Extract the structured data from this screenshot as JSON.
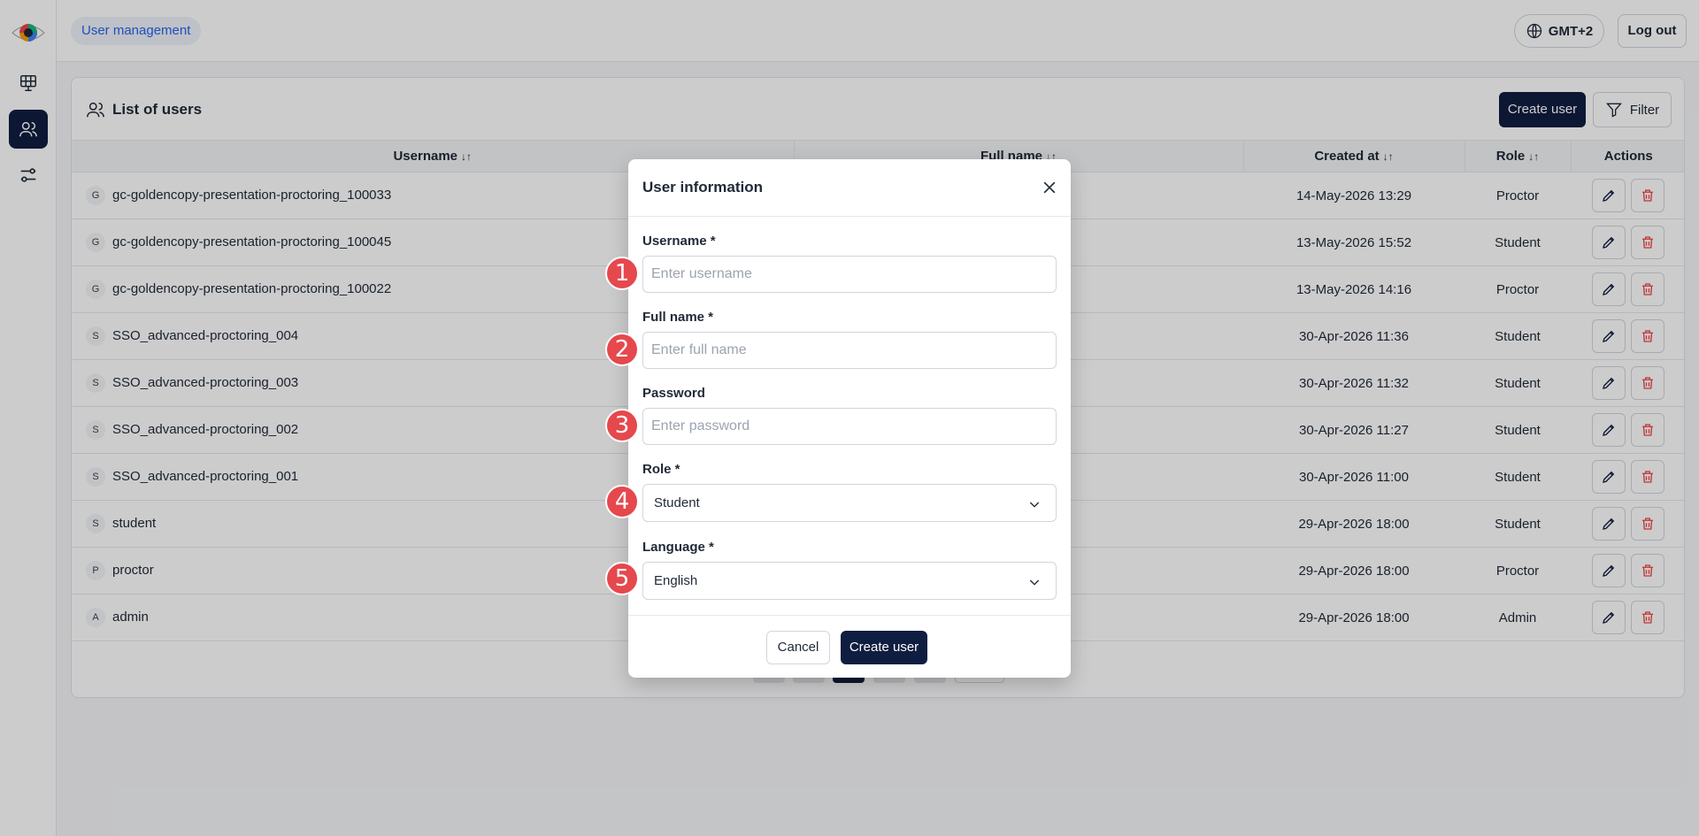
{
  "header": {
    "breadcrumb": "User management",
    "timezone_label": "GMT+2",
    "logout_label": "Log out"
  },
  "sidebar": {
    "items": [
      "dashboard",
      "users",
      "settings"
    ],
    "active": "users"
  },
  "card": {
    "title": "List of users",
    "create_label": "Create user",
    "filter_label": "Filter"
  },
  "table": {
    "columns": [
      "Username",
      "Full name",
      "Created at",
      "Role",
      "Actions"
    ],
    "rows": [
      {
        "initial": "G",
        "username": "gc-goldencopy-presentation-proctoring_100033",
        "created": "14-May-2026 13:29",
        "role": "Proctor"
      },
      {
        "initial": "G",
        "username": "gc-goldencopy-presentation-proctoring_100045",
        "created": "13-May-2026 15:52",
        "role": "Student"
      },
      {
        "initial": "G",
        "username": "gc-goldencopy-presentation-proctoring_100022",
        "created": "13-May-2026 14:16",
        "role": "Proctor"
      },
      {
        "initial": "S",
        "username": "SSO_advanced-proctoring_004",
        "created": "30-Apr-2026 11:36",
        "role": "Student"
      },
      {
        "initial": "S",
        "username": "SSO_advanced-proctoring_003",
        "created": "30-Apr-2026 11:32",
        "role": "Student"
      },
      {
        "initial": "S",
        "username": "SSO_advanced-proctoring_002",
        "created": "30-Apr-2026 11:27",
        "role": "Student"
      },
      {
        "initial": "S",
        "username": "SSO_advanced-proctoring_001",
        "created": "30-Apr-2026 11:00",
        "role": "Student"
      },
      {
        "initial": "S",
        "username": "student",
        "created": "29-Apr-2026 18:00",
        "role": "Student"
      },
      {
        "initial": "P",
        "username": "proctor",
        "created": "29-Apr-2026 18:00",
        "role": "Proctor"
      },
      {
        "initial": "A",
        "username": "admin",
        "created": "29-Apr-2026 18:00",
        "role": "Admin"
      }
    ]
  },
  "modal": {
    "title": "User information",
    "fields": {
      "username": {
        "label": "Username *",
        "placeholder": "Enter username",
        "value": ""
      },
      "full_name": {
        "label": "Full name *",
        "placeholder": "Enter full name",
        "value": ""
      },
      "password": {
        "label": "Password",
        "placeholder": "Enter password",
        "value": ""
      },
      "role": {
        "label": "Role *",
        "value": "Student"
      },
      "language": {
        "label": "Language *",
        "value": "English"
      }
    },
    "cancel_label": "Cancel",
    "submit_label": "Create user",
    "markers": [
      "1",
      "2",
      "3",
      "4",
      "5"
    ]
  },
  "colors": {
    "primary": "#0f1d40",
    "link": "#2563eb",
    "danger": "#ef4444",
    "marker": "#e5484d"
  }
}
